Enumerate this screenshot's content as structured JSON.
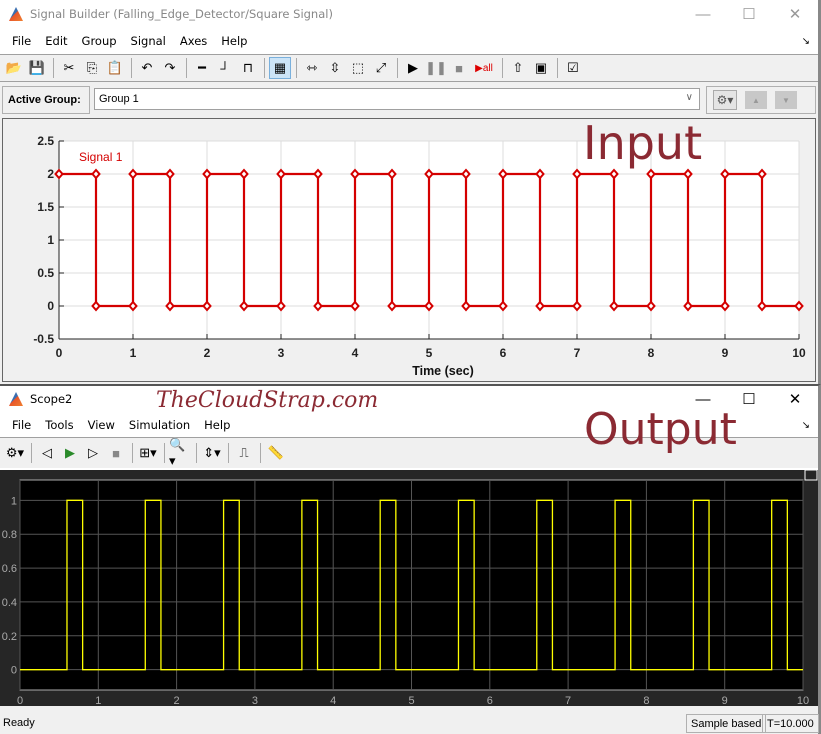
{
  "signal_builder": {
    "title": "Signal Builder (Falling_Edge_Detector/Square Signal)",
    "window_controls": {
      "minimize": "—",
      "maximize": "☐",
      "close": "✕"
    },
    "menu": [
      "File",
      "Edit",
      "Group",
      "Signal",
      "Axes",
      "Help"
    ],
    "toolbar": [
      {
        "name": "open-icon",
        "glyph": "📂"
      },
      {
        "name": "save-icon",
        "glyph": "💾"
      },
      {
        "sep": true
      },
      {
        "name": "cut-icon",
        "glyph": "✂"
      },
      {
        "name": "copy-icon",
        "glyph": "⎘"
      },
      {
        "name": "paste-icon",
        "glyph": "📋"
      },
      {
        "sep": true
      },
      {
        "name": "undo-icon",
        "glyph": "↶"
      },
      {
        "name": "redo-icon",
        "glyph": "↷"
      },
      {
        "sep": true
      },
      {
        "name": "constant-icon",
        "glyph": "━"
      },
      {
        "name": "step-icon",
        "glyph": "┘"
      },
      {
        "name": "pulse-icon",
        "glyph": "⊓"
      },
      {
        "sep": true
      },
      {
        "name": "grid-icon",
        "glyph": "▦",
        "active": true
      },
      {
        "sep": true
      },
      {
        "name": "zoom-x-icon",
        "glyph": "⇿"
      },
      {
        "name": "zoom-y-icon",
        "glyph": "⇳"
      },
      {
        "name": "zoom-xy-icon",
        "glyph": "⬚"
      },
      {
        "name": "fit-icon",
        "glyph": "⤢"
      },
      {
        "sep": true
      },
      {
        "name": "play-icon",
        "glyph": "▶"
      },
      {
        "name": "pause-icon",
        "glyph": "❚❚"
      },
      {
        "name": "stop-icon",
        "glyph": "■"
      },
      {
        "name": "run-all-icon",
        "glyph": "▶all"
      },
      {
        "sep": true
      },
      {
        "name": "up-arrow-icon",
        "glyph": "⇧"
      },
      {
        "name": "show-block-icon",
        "glyph": "▣"
      },
      {
        "sep": true
      },
      {
        "name": "verify-icon",
        "glyph": "☑"
      }
    ],
    "active_group_label": "Active Group:",
    "active_group_value": "Group 1",
    "overlay_label": "Input"
  },
  "scope": {
    "title": "Scope2",
    "window_controls": {
      "minimize": "—",
      "maximize": "☐",
      "close": "✕"
    },
    "menu": [
      "File",
      "Tools",
      "View",
      "Simulation",
      "Help"
    ],
    "watermark": "TheCloudStrap.com",
    "overlay_label": "Output",
    "toolbar": [
      {
        "name": "settings-icon",
        "glyph": "⚙▾"
      },
      {
        "sep": true
      },
      {
        "name": "step-back-icon",
        "glyph": "◁"
      },
      {
        "name": "run-icon",
        "glyph": "▶"
      },
      {
        "name": "step-forward-icon",
        "glyph": "▷"
      },
      {
        "name": "stop-icon",
        "glyph": "■"
      },
      {
        "sep": true
      },
      {
        "name": "signal-select-icon",
        "glyph": "⊞▾"
      },
      {
        "sep": true
      },
      {
        "name": "zoom-icon",
        "glyph": "🔍▾"
      },
      {
        "sep": true
      },
      {
        "name": "scale-icon",
        "glyph": "⇕▾"
      },
      {
        "sep": true
      },
      {
        "name": "triggers-icon",
        "glyph": "⎍"
      },
      {
        "sep": true
      },
      {
        "name": "measure-icon",
        "glyph": "📏"
      }
    ],
    "status": "Ready",
    "status_mode": "Sample based",
    "status_time": "T=10.000"
  },
  "chart_data": [
    {
      "type": "line",
      "title": "",
      "series": [
        {
          "name": "Signal 1",
          "color": "#d40000",
          "x": [
            0,
            0.5,
            0.5,
            1,
            1,
            1.5,
            1.5,
            2,
            2,
            2.5,
            2.5,
            3,
            3,
            3.5,
            3.5,
            4,
            4,
            4.5,
            4.5,
            5,
            5,
            5.5,
            5.5,
            6,
            6,
            6.5,
            6.5,
            7,
            7,
            7.5,
            7.5,
            8,
            8,
            8.5,
            8.5,
            9,
            9,
            9.5,
            9.5,
            10
          ],
          "y": [
            2,
            2,
            0,
            0,
            2,
            2,
            0,
            0,
            2,
            2,
            0,
            0,
            2,
            2,
            0,
            0,
            2,
            2,
            0,
            0,
            2,
            2,
            0,
            0,
            2,
            2,
            0,
            0,
            2,
            2,
            0,
            0,
            2,
            2,
            0,
            0,
            2,
            2,
            0,
            0
          ]
        }
      ],
      "xlabel": "Time (sec)",
      "ylabel": "",
      "xlim": [
        0,
        10
      ],
      "ylim": [
        -0.5,
        2.5
      ],
      "xticks": [
        "0",
        "1",
        "2",
        "3",
        "4",
        "5",
        "6",
        "7",
        "8",
        "9",
        "10"
      ],
      "yticks": [
        "-0.5",
        "0",
        "0.5",
        "1",
        "1.5",
        "2",
        "2.5"
      ],
      "grid": true
    },
    {
      "type": "line",
      "title": "",
      "series": [
        {
          "name": "Output",
          "color": "#ffff00",
          "pulses": [
            [
              0.6,
              0.8
            ],
            [
              1.6,
              1.8
            ],
            [
              2.6,
              2.8
            ],
            [
              3.6,
              3.8
            ],
            [
              4.6,
              4.8
            ],
            [
              5.6,
              5.8
            ],
            [
              6.6,
              6.8
            ],
            [
              7.6,
              7.8
            ],
            [
              8.6,
              8.8
            ],
            [
              9.6,
              9.8
            ]
          ]
        }
      ],
      "xlabel": "",
      "ylabel": "",
      "xlim": [
        0,
        10
      ],
      "ylim": [
        -0.12,
        1.12
      ],
      "xticks": [
        "0",
        "1",
        "2",
        "3",
        "4",
        "5",
        "6",
        "7",
        "8",
        "9",
        "10"
      ],
      "yticks": [
        "0",
        "0.2",
        "0.4",
        "0.6",
        "0.8",
        "1"
      ],
      "grid": true
    }
  ]
}
